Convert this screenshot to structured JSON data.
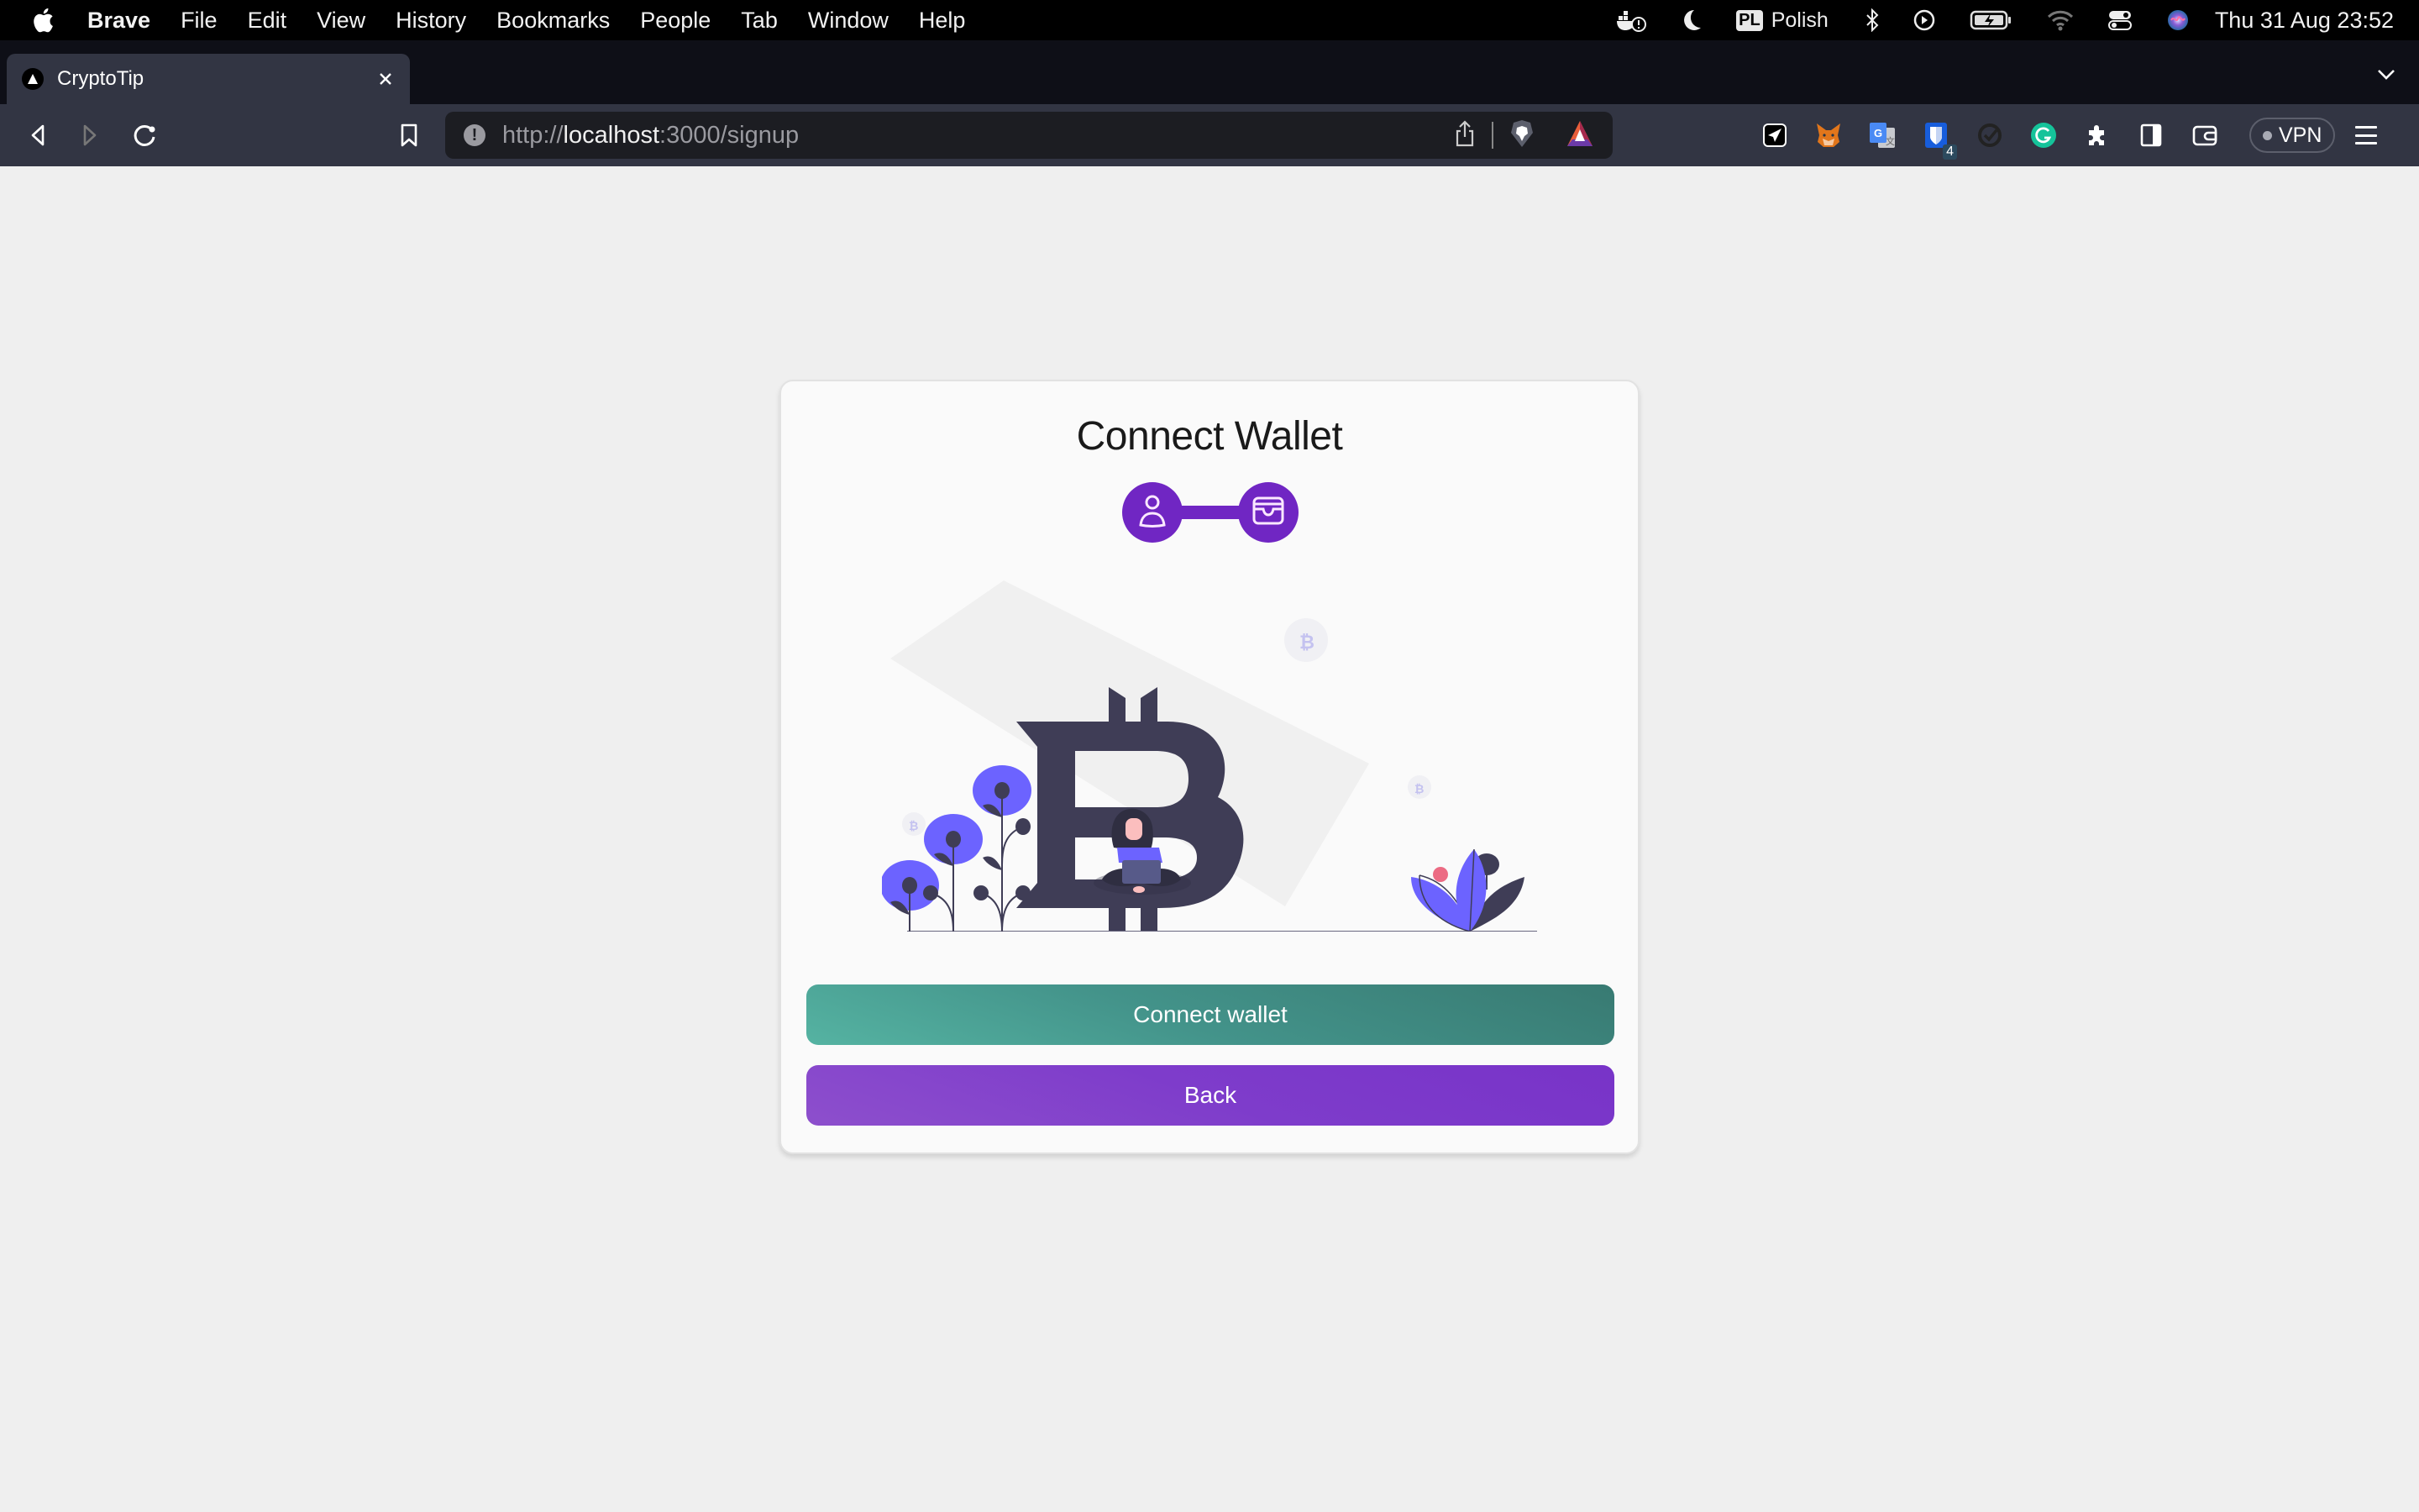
{
  "menubar": {
    "app_name": "Brave",
    "items": [
      "File",
      "Edit",
      "View",
      "History",
      "Bookmarks",
      "People",
      "Tab",
      "Window",
      "Help"
    ],
    "status": {
      "input_source_badge": "PL",
      "input_source_label": "Polish",
      "clock": "Thu 31 Aug  23:52"
    }
  },
  "browser": {
    "tab": {
      "title": "CryptoTip",
      "close_label": "×"
    },
    "new_tab_label": "+",
    "url": {
      "scheme": "http://",
      "host": "localhost",
      "rest": ":3000/signup"
    },
    "extensions": [
      {
        "name": "send-extension"
      },
      {
        "name": "metamask-extension"
      },
      {
        "name": "google-translate-extension"
      },
      {
        "name": "bitwarden-extension",
        "badge": "4"
      },
      {
        "name": "timer-extension"
      },
      {
        "name": "grammarly-extension"
      }
    ],
    "vpn_label": "VPN"
  },
  "page": {
    "title": "Connect Wallet",
    "stepper": {
      "steps": [
        "user",
        "wallet"
      ],
      "color": "#7026c3"
    },
    "buttons": {
      "connect": "Connect wallet",
      "back": "Back"
    },
    "colors": {
      "connect_button": "#43938a",
      "back_button": "#7e3ccb",
      "illustration_accent": "#6c63ff",
      "illustration_dark": "#3f3d56",
      "illustration_pink": "#ec6b83"
    }
  }
}
